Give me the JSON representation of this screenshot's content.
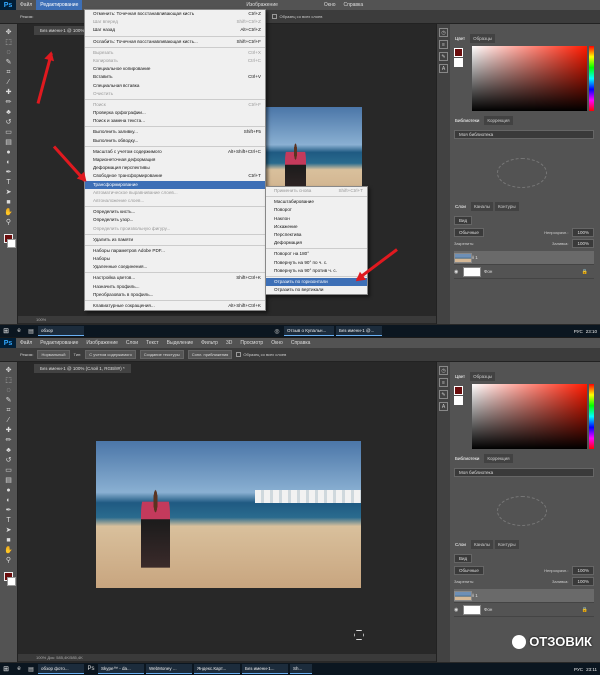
{
  "menu": [
    "Ps",
    "Файл",
    "Редактирование",
    "Изображение",
    "Слои",
    "Текст",
    "Выделение",
    "Фильтр",
    "3D",
    "Просмотр",
    "Окно",
    "Справка"
  ],
  "options": {
    "mode_label": "Режим:",
    "mode_value": "Нормальный",
    "type_label": "Тип:",
    "btn_content": "С учетом содержимого",
    "btn_texture": "Создание текстуры",
    "btn_close": "Сопл. приближения",
    "sample_all": "Образец со всех слоев"
  },
  "doc_tab": "Без имени-1 @ 100% (Слой 1, RGB/8#) *",
  "doc_tab_short": "Без имени-1 @ 100%",
  "doc_tab_short2": "бь",
  "status": "100%",
  "status2": "Док: 585,4K/585,4K",
  "panels": {
    "color_tabs": [
      "Цвет",
      "Образцы"
    ],
    "lib_tabs": [
      "Библиотеки",
      "Коррекция"
    ],
    "lib_name": "Моя библиотека",
    "layer_tabs": [
      "Слои",
      "Каналы",
      "Контуры"
    ],
    "filter": "Вид",
    "blend": "Обычные",
    "opacity_label": "Непрозрачн.:",
    "opacity": "100%",
    "lock_label": "Закрепить:",
    "fill_label": "Заливка:",
    "fill": "100%",
    "layer1": "Слой 1",
    "background": "Фон"
  },
  "edit_menu": [
    {
      "label": "Отменить: Точечная восстанавливающая кисть",
      "sc": "Ctrl+Z",
      "dis": false
    },
    {
      "label": "Шаг вперед",
      "sc": "Shift+Ctrl+Z",
      "dis": true
    },
    {
      "label": "Шаг назад",
      "sc": "Alt+Ctrl+Z",
      "dis": false
    },
    {
      "sep": true
    },
    {
      "label": "Ослабить: Точечная восстанавливающая кисть...",
      "sc": "Shift+Ctrl+F",
      "dis": false
    },
    {
      "sep": true
    },
    {
      "label": "Вырезать",
      "sc": "Ctrl+X",
      "dis": true
    },
    {
      "label": "Копировать",
      "sc": "Ctrl+C",
      "dis": true
    },
    {
      "label": "Специальное копирование",
      "sc": "",
      "dis": false
    },
    {
      "label": "Вставить",
      "sc": "Ctrl+V",
      "dis": false
    },
    {
      "label": "Специальная вставка",
      "sc": "",
      "dis": false
    },
    {
      "label": "Очистить",
      "sc": "",
      "dis": true
    },
    {
      "sep": true
    },
    {
      "label": "Поиск",
      "sc": "Ctrl+F",
      "dis": true
    },
    {
      "label": "Проверка орфографии...",
      "sc": "",
      "dis": false
    },
    {
      "label": "Поиск и замена текста...",
      "sc": "",
      "dis": false
    },
    {
      "sep": true
    },
    {
      "label": "Выполнить заливку...",
      "sc": "Shift+F5",
      "dis": false
    },
    {
      "label": "Выполнить обводку...",
      "sc": "",
      "dis": false
    },
    {
      "sep": true
    },
    {
      "label": "Масштаб с учетом содержимого",
      "sc": "Alt+Shift+Ctrl+C",
      "dis": false
    },
    {
      "label": "Марионеточная деформация",
      "sc": "",
      "dis": false
    },
    {
      "label": "Деформация перспективы",
      "sc": "",
      "dis": false
    },
    {
      "label": "Свободное трансформирование",
      "sc": "Ctrl+T",
      "dis": false
    },
    {
      "label": "Трансформирование",
      "sc": "",
      "dis": false,
      "hi": true
    },
    {
      "label": "Автоматическое выравнивание слоев...",
      "sc": "",
      "dis": true
    },
    {
      "label": "Автоналожение слоев...",
      "sc": "",
      "dis": true
    },
    {
      "sep": true
    },
    {
      "label": "Определить кисть...",
      "sc": "",
      "dis": false
    },
    {
      "label": "Определить узор...",
      "sc": "",
      "dis": false
    },
    {
      "label": "Определить произвольную фигуру...",
      "sc": "",
      "dis": true
    },
    {
      "sep": true
    },
    {
      "label": "Удалить из памяти",
      "sc": "",
      "dis": false
    },
    {
      "sep": true
    },
    {
      "label": "Наборы параметров Adobe PDF...",
      "sc": "",
      "dis": false
    },
    {
      "label": "Наборы",
      "sc": "",
      "dis": false
    },
    {
      "label": "Удаленные соединения...",
      "sc": "",
      "dis": false
    },
    {
      "sep": true
    },
    {
      "label": "Настройка цветов...",
      "sc": "Shift+Ctrl+K",
      "dis": false
    },
    {
      "label": "Назначить профиль...",
      "sc": "",
      "dis": false
    },
    {
      "label": "Преобразовать в профиль...",
      "sc": "",
      "dis": false
    },
    {
      "sep": true
    },
    {
      "label": "Клавиатурные сокращения...",
      "sc": "Alt+Shift+Ctrl+K",
      "dis": false
    }
  ],
  "transform_menu": [
    {
      "label": "Применить снова",
      "sc": "Shift+Ctrl+T",
      "dis": true
    },
    {
      "sep": true
    },
    {
      "label": "Масштабирование",
      "sc": "",
      "dis": false
    },
    {
      "label": "Поворот",
      "sc": "",
      "dis": false
    },
    {
      "label": "Наклон",
      "sc": "",
      "dis": false
    },
    {
      "label": "Искажение",
      "sc": "",
      "dis": false
    },
    {
      "label": "Перспектива",
      "sc": "",
      "dis": false
    },
    {
      "label": "Деформация",
      "sc": "",
      "dis": false
    },
    {
      "sep": true
    },
    {
      "label": "Поворот на 180°",
      "sc": "",
      "dis": false
    },
    {
      "label": "Повернуть на 90° по ч. с.",
      "sc": "",
      "dis": false
    },
    {
      "label": "Повернуть на 90° против ч. с.",
      "sc": "",
      "dis": false
    },
    {
      "sep": true
    },
    {
      "label": "Отразить по горизонтали",
      "sc": "",
      "dis": false,
      "hi": true
    },
    {
      "label": "Отразить по вертикали",
      "sc": "",
      "dis": false
    }
  ],
  "taskbar1": {
    "apps": [
      "обзор",
      "Отзыв о Купальн...",
      "Без имени-1 @..."
    ],
    "lang": "РУС",
    "time": "23:10"
  },
  "taskbar2": {
    "apps": [
      "обзор фото...",
      "Skype™ - da...",
      "WebMoney ...",
      "Яндекс.Карт...",
      "Без имени-1...",
      "Sh..."
    ],
    "lang": "РУС",
    "time": "23:11"
  },
  "watermark": "ОТЗОВИК",
  "accent": "#3d6fb6",
  "arrow_color": "#e0191f",
  "fg_color": "#6b0d0d"
}
